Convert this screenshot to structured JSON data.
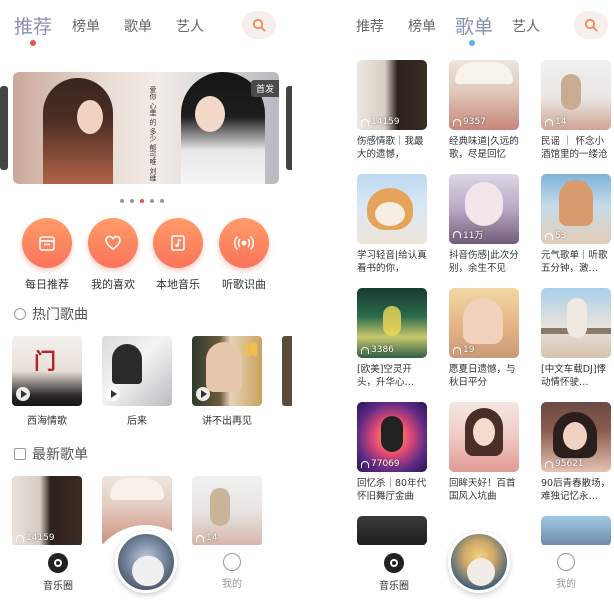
{
  "left": {
    "tabs": [
      {
        "label": "推荐",
        "active": true
      },
      {
        "label": "榜单",
        "active": false
      },
      {
        "label": "歌单",
        "active": false
      },
      {
        "label": "艺人",
        "active": false
      }
    ],
    "banner": {
      "badge": "首发",
      "text": "爱你 心里 的 多少 郁可唯 刘维"
    },
    "quick_actions": [
      {
        "label": "每日推荐",
        "icon": "calendar-icon"
      },
      {
        "label": "我的喜欢",
        "icon": "heart-icon"
      },
      {
        "label": "本地音乐",
        "icon": "music-file-icon"
      },
      {
        "label": "听歌识曲",
        "icon": "sound-wave-icon"
      }
    ],
    "hot_songs_title": "热门歌曲",
    "hot_songs": [
      {
        "title": "西海情歌"
      },
      {
        "title": "后来"
      },
      {
        "title": "讲不出再见"
      }
    ],
    "new_playlists_title": "最新歌单",
    "new_playlists": [
      {
        "count": "14159"
      },
      {
        "count": ""
      },
      {
        "count": "14"
      }
    ],
    "nav": {
      "music": "音乐圈",
      "me": "我的"
    }
  },
  "right": {
    "tabs": [
      {
        "label": "推荐",
        "active": false
      },
      {
        "label": "榜单",
        "active": false
      },
      {
        "label": "歌单",
        "active": true
      },
      {
        "label": "艺人",
        "active": false
      }
    ],
    "playlists": [
      {
        "title": "伤感情歌｜我最大的遗憾，",
        "count": "14159"
      },
      {
        "title": "经典味道|久远的歌，尽是回忆",
        "count": "9357"
      },
      {
        "title": "民谣 ｜ 怀念小酒馆里的一缕沧桑",
        "count": "14"
      },
      {
        "title": "学习轻音|给认真看书的你，",
        "count": ""
      },
      {
        "title": "抖音伤感|此次分别，余生不见",
        "count": "11万"
      },
      {
        "title": "元气歌单｜听歌五分钟，激…",
        "count": "53"
      },
      {
        "title": "[欧美]空灵开头，升华心…",
        "count": "3386"
      },
      {
        "title": "愿夏日遗憾，与秋日平分",
        "count": "19"
      },
      {
        "title": "[中文车载DJ]悸动情怀驶…",
        "count": ""
      },
      {
        "title": "回忆杀｜80年代怀旧舞厅金曲",
        "count": "77069"
      },
      {
        "title": "回眸天好！百首国风入坑曲",
        "count": ""
      },
      {
        "title": "90后青春散场，难独记忆永…",
        "count": "95621"
      }
    ],
    "nav": {
      "music": "音乐圈",
      "me": "我的"
    }
  },
  "colors": {
    "accent": "#f9735a",
    "active_tab": "#8a8fb0",
    "dot_left": "#e9514a",
    "dot_right": "#5bb4e8"
  }
}
